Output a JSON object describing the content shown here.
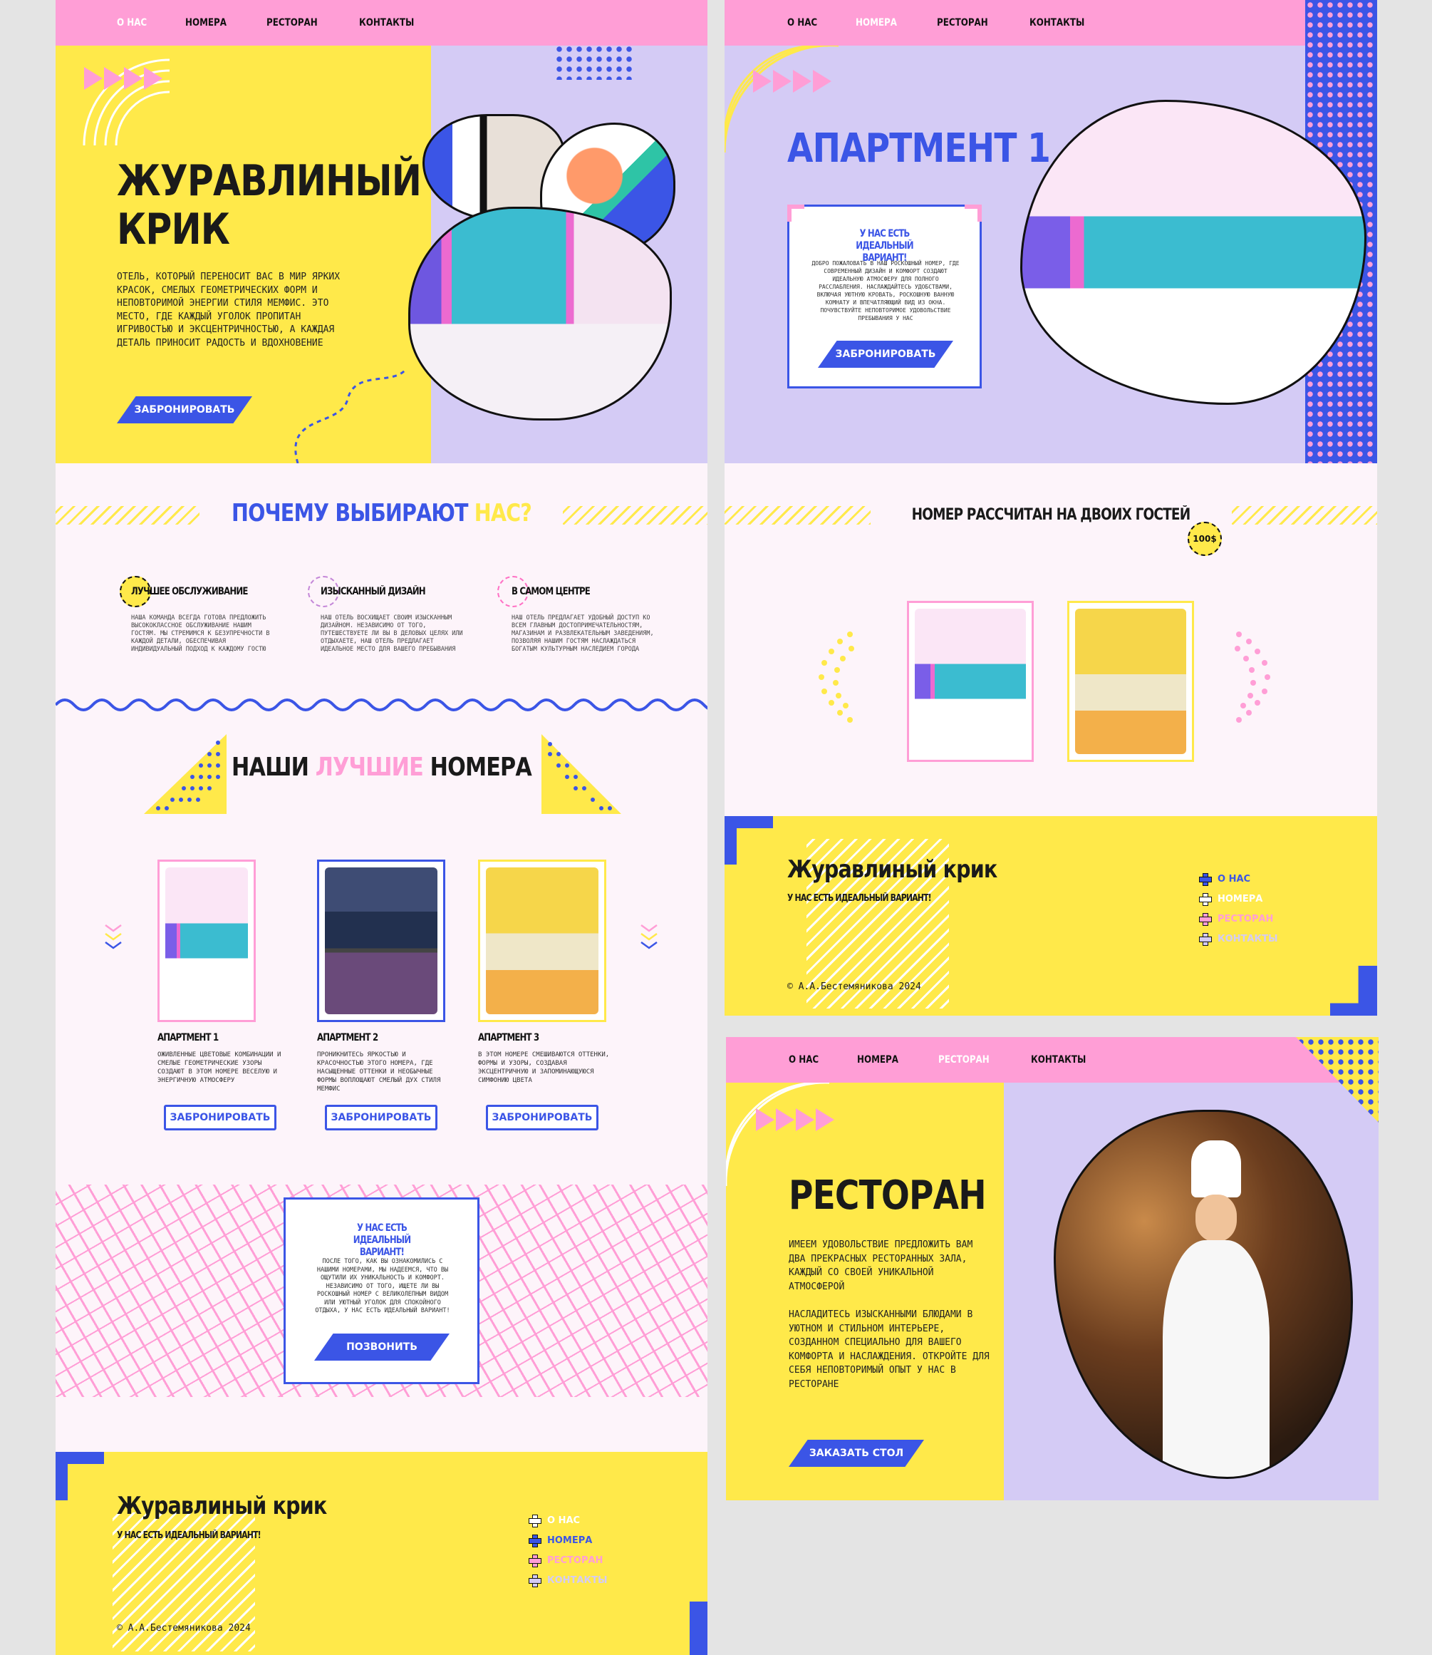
{
  "nav": {
    "about": "О НАС",
    "rooms": "НОМЕРА",
    "restaurant": "РЕСТОРАН",
    "contacts": "КОНТАКТЫ"
  },
  "home": {
    "title_line1": "ЖУРАВЛИНЫЙ",
    "title_line2": "КРИК",
    "description": "ОТЕЛЬ, КОТОРЫЙ ПЕРЕНОСИТ ВАС В МИР ЯРКИХ КРАСОК, СМЕЛЫХ ГЕОМЕТРИЧЕСКИХ ФОРМ И НЕПОВТОРИМОЙ ЭНЕРГИИ СТИЛЯ МЕМФИС. ЭТО МЕСТО, ГДЕ КАЖДЫЙ УГОЛОК ПРОПИТАН ИГРИВОСТЬЮ И ЭКСЦЕНТРИЧНОСТЬЮ, А КАЖДАЯ ДЕТАЛЬ ПРИНОСИТ РАДОСТЬ И ВДОХНОВЕНИЕ",
    "book_button": "ЗАБРОНИРОВАТЬ",
    "why_part1": "ПОЧЕМУ ВЫБИРАЮТ",
    "why_part2": "НАС?",
    "features": [
      {
        "title": "ЛУЧШЕЕ ОБСЛУЖИВАНИЕ",
        "text": "НАША КОМАНДА ВСЕГДА ГОТОВА ПРЕДЛОЖИТЬ ВЫСОКОКЛАССНОЕ ОБСЛУЖИВАНИЕ НАШИМ ГОСТЯМ. МЫ СТРЕМИМСЯ К БЕЗУПРЕЧНОСТИ В КАЖДОЙ ДЕТАЛИ, ОБЕСПЕЧИВАЯ ИНДИВИДУАЛЬНЫЙ ПОДХОД К КАЖДОМУ ГОСТЮ"
      },
      {
        "title": "ИЗЫСКАННЫЙ ДИЗАЙН",
        "text": "НАШ ОТЕЛЬ ВОСХИЩАЕТ СВОИМ ИЗЫСКАННЫМ ДИЗАЙНОМ. НЕЗАВИСИМО ОТ ТОГО, ПУТЕШЕСТВУЕТЕ ЛИ ВЫ В ДЕЛОВЫХ ЦЕЛЯХ ИЛИ ОТДЫХАЕТЕ, НАШ ОТЕЛЬ ПРЕДЛАГАЕТ ИДЕАЛЬНОЕ МЕСТО ДЛЯ ВАШЕГО ПРЕБЫВАНИЯ"
      },
      {
        "title": "В САМОМ ЦЕНТРЕ",
        "text": "НАШ ОТЕЛЬ ПРЕДЛАГАЕТ УДОБНЫЙ ДОСТУП КО ВСЕМ ГЛАВНЫМ ДОСТОПРИМЕЧАТЕЛЬНОСТЯМ, МАГАЗИНАМ И РАЗВЛЕКАТЕЛЬНЫМ ЗАВЕДЕНИЯМ, ПОЗВОЛЯЯ НАШИМ ГОСТЯМ НАСЛАЖДАТЬСЯ БОГАТЫМ КУЛЬТУРНЫМ НАСЛЕДИЕМ ГОРОДА"
      }
    ],
    "best_part1": "НАШИ",
    "best_part2": "ЛУЧШИЕ",
    "best_part3": "НОМЕРА",
    "rooms": [
      {
        "title": "АПАРТМЕНТ 1",
        "text": "ОЖИВЛЕННЫЕ ЦВЕТОВЫЕ КОМБИНАЦИИ И СМЕЛЫЕ ГЕОМЕТРИЧЕСКИЕ УЗОРЫ СОЗДАЮТ В ЭТОМ НОМЕРЕ ВЕСЕЛУЮ И ЭНЕРГИЧНУЮ АТМОСФЕРУ",
        "button": "ЗАБРОНИРОВАТЬ"
      },
      {
        "title": "АПАРТМЕНТ 2",
        "text": "ПРОНИКНИТЕСЬ ЯРКОСТЬЮ И КРАСОЧНОСТЬЮ ЭТОГО НОМЕРА, ГДЕ НАСЫЩЕННЫЕ ОТТЕНКИ И НЕОБЫЧНЫЕ ФОРМЫ ВОПЛОЩАЮТ СМЕЛЫЙ ДУХ СТИЛЯ МЕМФИС",
        "button": "ЗАБРОНИРОВАТЬ"
      },
      {
        "title": "АПАРТМЕНТ 3",
        "text": "В ЭТОМ НОМЕРЕ СМЕШИВАЮТСЯ ОТТЕНКИ, ФОРМЫ И УЗОРЫ, СОЗДАВАЯ ЭКСЦЕНТРИЧНУЮ И ЗАПОМИНАЮЩУЮСЯ СИМФОНИЮ ЦВЕТА",
        "button": "ЗАБРОНИРОВАТЬ"
      }
    ],
    "cta_title": "У НАС ЕСТЬ ИДЕАЛЬНЫЙ ВАРИАНТ!",
    "cta_text": "ПОСЛЕ ТОГО, КАК ВЫ ОЗНАКОМИЛИСЬ С НАШИМИ НОМЕРАМИ, МЫ НАДЕЕМСЯ, ЧТО ВЫ ОЩУТИЛИ ИХ УНИКАЛЬНОСТЬ И КОМФОРТ. НЕЗАВИСИМО ОТ ТОГО, ИЩЕТЕ ЛИ ВЫ РОСКОШНЫЙ НОМЕР С ВЕЛИКОЛЕПНЫМ ВИДОМ ИЛИ УЮТНЫЙ УГОЛОК ДЛЯ СПОКОЙНОГО ОТДЫХА, У НАС ЕСТЬ ИДЕАЛЬНЫЙ ВАРИАНТ!",
    "cta_button": "ПОЗВОНИТЬ"
  },
  "footer": {
    "brand": "Журавлиный крик",
    "tagline": "У НАС ЕСТЬ ИДЕАЛЬНЫЙ ВАРИАНТ!",
    "copyright": "© А.А.Бестемяникова 2024"
  },
  "apartment": {
    "title": "АПАРТМЕНТ 1",
    "card_title": "У НАС ЕСТЬ ИДЕАЛЬНЫЙ ВАРИАНТ!",
    "card_text": "ДОБРО ПОЖАЛОВАТЬ В НАШ РОСКОШНЫЙ НОМЕР, ГДЕ СОВРЕМЕННЫЙ ДИЗАЙН И КОМФОРТ СОЗДАЮТ ИДЕАЛЬНУЮ АТМОСФЕРУ ДЛЯ ПОЛНОГО РАССЛАБЛЕНИЯ. НАСЛАЖДАЙТЕСЬ УДОБСТВАМИ, ВКЛЮЧАЯ УЮТНУЮ КРОВАТЬ, РОСКОШНУЮ ВАННУЮ КОМНАТУ И ВПЕЧАТЛЯЮЩИЙ ВИД ИЗ ОКНА. ПОЧУВСТВУЙТЕ НЕПОВТОРИМОЕ УДОВОЛЬСТВИЕ ПРЕБЫВАНИЯ У НАС",
    "card_button": "ЗАБРОНИРОВАТЬ",
    "guests": "НОМЕР РАССЧИТАН НА ДВОИХ ГОСТЕЙ",
    "price": "100$"
  },
  "restaurant": {
    "title": "РЕСТОРАН",
    "text1": "ИМЕЕМ УДОВОЛЬСТВИЕ ПРЕДЛОЖИТЬ ВАМ ДВА ПРЕКРАСНЫХ РЕСТОРАННЫХ ЗАЛА, КАЖДЫЙ СО СВОЕЙ УНИКАЛЬНОЙ АТМОСФЕРОЙ",
    "text2": "НАСЛАДИТЕСЬ ИЗЫСКАННЫМИ БЛЮДАМИ В УЮТНОМ И СТИЛЬНОМ ИНТЕРЬЕРЕ, СОЗДАННОМ СПЕЦИАЛЬНО ДЛЯ ВАШЕГО КОМФОРТА И НАСЛАЖДЕНИЯ. ОТКРОЙТЕ ДЛЯ СЕБЯ НЕПОВТОРИМЫЙ ОПЫТ У НАС В РЕСТОРАНЕ",
    "button": "ЗАКАЗАТЬ СТОЛ"
  },
  "colors": {
    "yellow": "#ffe94a",
    "pink": "#ff9ed6",
    "blue": "#3b55e6",
    "lavender": "#d4cbf5",
    "background": "#fdf4fa"
  },
  "icons": [
    "triangle-arrows-icon",
    "chevron-down-icon",
    "cross-icon",
    "dashed-circle-icon"
  ]
}
